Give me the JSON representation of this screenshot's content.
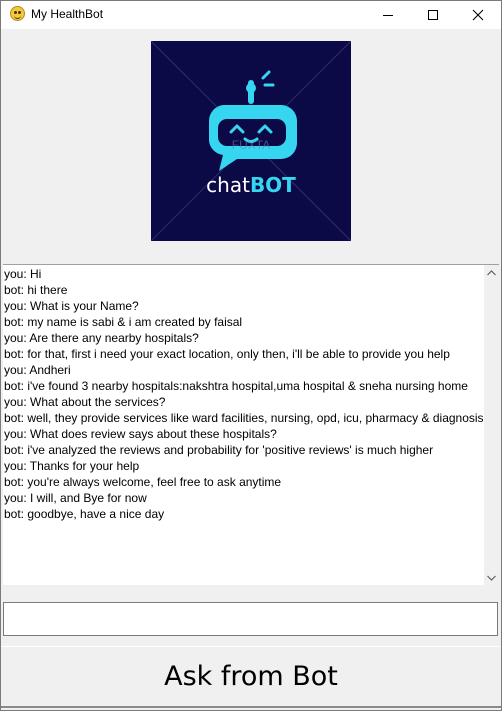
{
  "window": {
    "title": "My HealthBot",
    "app_icon": "smiley-emoji-icon",
    "controls": [
      "minimize-icon",
      "maximize-icon",
      "close-icon"
    ]
  },
  "logo": {
    "text_chat": "chat",
    "text_bot": "BOT",
    "watermark": "FUXTA",
    "colors": {
      "background": "#0c0a46",
      "accent": "#36d6f0"
    }
  },
  "chat": {
    "lines": [
      "you: Hi",
      "bot: hi there",
      "you: What is your Name?",
      "bot: my name is sabi & i am created by faisal",
      "you: Are there any nearby hospitals?",
      "bot: for that, first i need your exact location, only then, i'll be able to provide you help",
      "you: Andheri",
      "bot: i've found 3 nearby hospitals:nakshtra hospital,uma hospital & sneha nursing home",
      "you: What about the services?",
      "bot: well, they provide services like ward facilities, nursing, opd, icu, pharmacy & diagnosis,",
      "you: What does review says about these hospitals?",
      "bot: i've analyzed the reviews and probability for 'positive reviews' is much higher",
      "you: Thanks for your help",
      "bot: you're always welcome, feel free to ask anytime",
      "you: I will, and Bye for now",
      "bot: goodbye, have a nice day"
    ]
  },
  "input": {
    "value": ""
  },
  "ask_button": {
    "label": "Ask from Bot"
  }
}
